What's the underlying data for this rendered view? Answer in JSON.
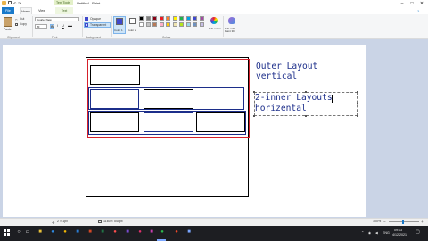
{
  "titlebar": {
    "contextual_tab": "Text Tools",
    "window_title": "Untitled - Paint",
    "min": "–",
    "max": "□",
    "close": "✕"
  },
  "tabs": {
    "file": "File",
    "home": "Home",
    "view": "View",
    "text": "Text"
  },
  "ribbon": {
    "clipboard": {
      "paste": "Paste",
      "cut": "Cut",
      "copy": "Copy",
      "group": "Clipboard"
    },
    "font": {
      "family": "Courier New",
      "size": "20",
      "bold": "B",
      "italic": "I",
      "underline": "U",
      "strike": "abc",
      "group": "Font"
    },
    "background": {
      "opaque": "Opaque",
      "transparent": "Transparent",
      "group": "Background"
    },
    "colors": {
      "color1": "Color 1",
      "color2": "Color 2",
      "edit_colors": "Edit colors",
      "edit_paint3d": "Edit with Paint 3D",
      "group": "Colors",
      "palette": [
        "#000000",
        "#7f7f7f",
        "#880015",
        "#ed1c24",
        "#ff7f27",
        "#fff200",
        "#22b14c",
        "#00a2e8",
        "#3f48cc",
        "#a349a4",
        "#ffffff",
        "#c3c3c3",
        "#b97a57",
        "#ffaec9",
        "#ffc90e",
        "#efe4b0",
        "#b5e61d",
        "#99d9ea",
        "#7092be",
        "#c8bfe7"
      ],
      "color1_value": "#3f48cc",
      "color2_value": "#ffffff"
    }
  },
  "canvas": {
    "outer_note": [
      "Outer Layout",
      "vertical"
    ],
    "inner_note": [
      "2-inner Layouts",
      "horizental"
    ]
  },
  "statusbar": {
    "position": "2 × 1px",
    "size": "1160 × 545px",
    "zoom": "100%",
    "zoom_minus": "−",
    "zoom_plus": "+"
  },
  "taskbar": {
    "lang": "ENG",
    "time": "09:13",
    "date": "4/12/2021"
  }
}
